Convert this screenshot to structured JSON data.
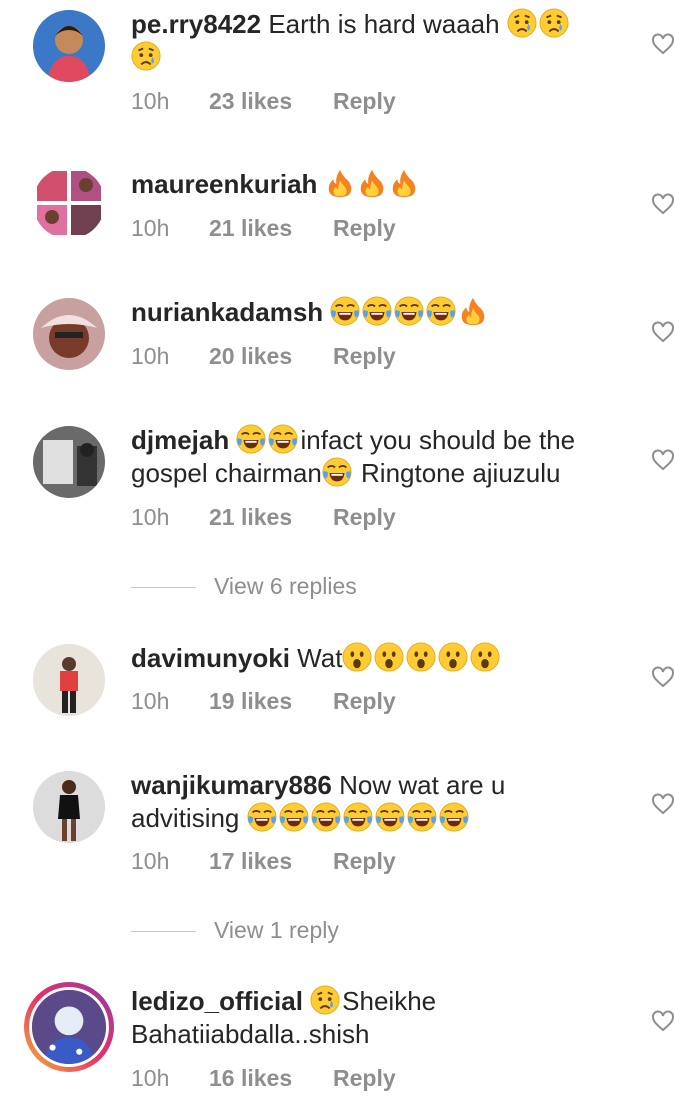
{
  "comments": [
    {
      "username": "pe.rry8422",
      "text_before": "Earth is hard waaah",
      "emojis": [
        "sad-tear",
        "sad-tear",
        "sad-tear"
      ],
      "text_after": "",
      "time": "10h",
      "likes": "23 likes",
      "reply": "Reply"
    },
    {
      "username": "maureenkuriah",
      "text_before": "",
      "emojis": [
        "fire",
        "fire",
        "fire"
      ],
      "text_after": "",
      "time": "10h",
      "likes": "21 likes",
      "reply": "Reply"
    },
    {
      "username": "nuriankadamsh",
      "text_before": "",
      "emojis": [
        "joy",
        "joy",
        "joy",
        "joy",
        "fire"
      ],
      "text_after": "",
      "time": "10h",
      "likes": "20 likes",
      "reply": "Reply"
    },
    {
      "username": "djmejah",
      "text_a": "infact you should be the gospel chairman",
      "text_b": "Ringtone ajiuzulu",
      "time": "10h",
      "likes": "21 likes",
      "reply": "Reply"
    },
    {
      "username": "davimunyoki",
      "text_before": "Wat",
      "emojis": [
        "astonished",
        "astonished",
        "astonished",
        "astonished",
        "astonished"
      ],
      "time": "10h",
      "likes": "19 likes",
      "reply": "Reply"
    },
    {
      "username": "wanjikumary886",
      "text_before": "Now wat are u",
      "text_line2": "advitising",
      "emojis": [
        "joy",
        "joy",
        "joy",
        "joy",
        "joy",
        "joy",
        "joy"
      ],
      "time": "10h",
      "likes": "17 likes",
      "reply": "Reply"
    },
    {
      "username": "ledizo_official",
      "text_before": "Sheikhe",
      "text_line2": "Bahatiiabdalla..shish",
      "emojis": [
        "sad-tear"
      ],
      "time": "10h",
      "likes": "16 likes",
      "reply": "Reply"
    }
  ],
  "view_replies": [
    {
      "label": "View 6 replies"
    },
    {
      "label": "View 1 reply"
    }
  ],
  "icons": {
    "like": "heart-outline-icon"
  },
  "colors": {
    "text": "#262626",
    "muted": "#8e8e8e",
    "divider": "#c7c7c7"
  }
}
